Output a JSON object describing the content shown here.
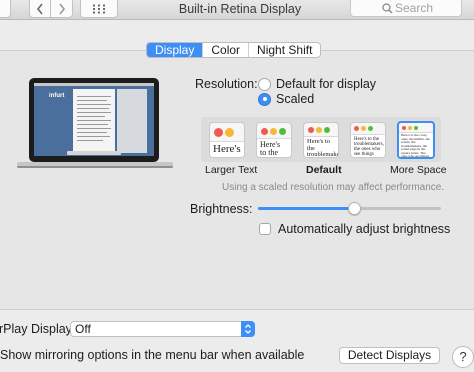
{
  "window": {
    "title": "Built-in Retina Display",
    "search_placeholder": "Search"
  },
  "tabs": [
    {
      "label": "Display",
      "active": true
    },
    {
      "label": "Color",
      "active": false
    },
    {
      "label": "Night Shift",
      "active": false
    }
  ],
  "laptop_screen": {
    "logo_text": "infurt"
  },
  "resolution": {
    "label": "Resolution:",
    "options": [
      {
        "label": "Default for display",
        "selected": false
      },
      {
        "label": "Scaled",
        "selected": true
      }
    ]
  },
  "scaled_options": {
    "thumbnails": [
      {
        "text": "Here's",
        "selected": false
      },
      {
        "text": "Here's to the troublemak",
        "selected": false
      },
      {
        "text": "Here's to the troublemakers ones who see",
        "selected": false
      },
      {
        "text": "Here's to the troublemakers, the ones who see things differently",
        "selected": false
      },
      {
        "text": "Here's to the crazy ones, the misfits, the rebels, the troublemakers, the round pegs in the square holes. The ones who see things differently",
        "selected": true
      }
    ],
    "labels": {
      "larger": "Larger Text",
      "default": "Default",
      "more": "More Space"
    },
    "note": "Using a scaled resolution may affect performance."
  },
  "brightness": {
    "label": "Brightness:",
    "level": 0.53,
    "auto_label": "Automatically adjust brightness",
    "auto_checked": false
  },
  "airplay": {
    "label": "rPlay Display:",
    "value": "Off"
  },
  "mirroring": {
    "label": "Show mirroring options in the menu bar when available"
  },
  "detect_button": "Detect Displays",
  "help_button": "?",
  "colors": {
    "accent": "#3d8ff5",
    "traffic_red": "#ee5b52",
    "traffic_yellow": "#f5b935",
    "traffic_green": "#4fbf3a"
  }
}
